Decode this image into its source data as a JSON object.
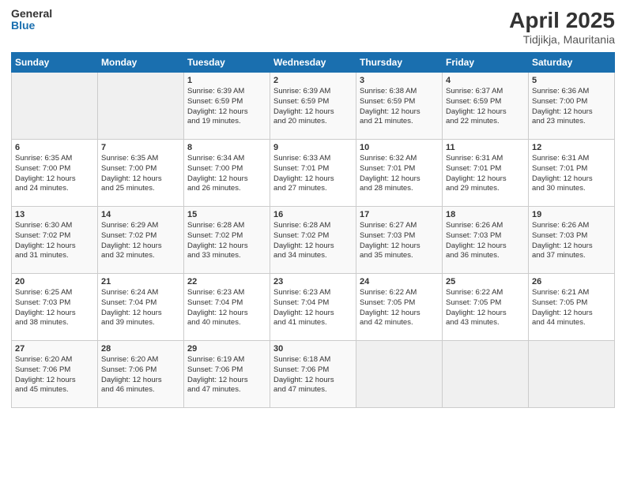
{
  "header": {
    "logo_general": "General",
    "logo_blue": "Blue",
    "title": "April 2025",
    "subtitle": "Tidjikja, Mauritania"
  },
  "calendar": {
    "days_of_week": [
      "Sunday",
      "Monday",
      "Tuesday",
      "Wednesday",
      "Thursday",
      "Friday",
      "Saturday"
    ],
    "weeks": [
      [
        {
          "day": "",
          "info": ""
        },
        {
          "day": "",
          "info": ""
        },
        {
          "day": "1",
          "info": "Sunrise: 6:39 AM\nSunset: 6:59 PM\nDaylight: 12 hours\nand 19 minutes."
        },
        {
          "day": "2",
          "info": "Sunrise: 6:39 AM\nSunset: 6:59 PM\nDaylight: 12 hours\nand 20 minutes."
        },
        {
          "day": "3",
          "info": "Sunrise: 6:38 AM\nSunset: 6:59 PM\nDaylight: 12 hours\nand 21 minutes."
        },
        {
          "day": "4",
          "info": "Sunrise: 6:37 AM\nSunset: 6:59 PM\nDaylight: 12 hours\nand 22 minutes."
        },
        {
          "day": "5",
          "info": "Sunrise: 6:36 AM\nSunset: 7:00 PM\nDaylight: 12 hours\nand 23 minutes."
        }
      ],
      [
        {
          "day": "6",
          "info": "Sunrise: 6:35 AM\nSunset: 7:00 PM\nDaylight: 12 hours\nand 24 minutes."
        },
        {
          "day": "7",
          "info": "Sunrise: 6:35 AM\nSunset: 7:00 PM\nDaylight: 12 hours\nand 25 minutes."
        },
        {
          "day": "8",
          "info": "Sunrise: 6:34 AM\nSunset: 7:00 PM\nDaylight: 12 hours\nand 26 minutes."
        },
        {
          "day": "9",
          "info": "Sunrise: 6:33 AM\nSunset: 7:01 PM\nDaylight: 12 hours\nand 27 minutes."
        },
        {
          "day": "10",
          "info": "Sunrise: 6:32 AM\nSunset: 7:01 PM\nDaylight: 12 hours\nand 28 minutes."
        },
        {
          "day": "11",
          "info": "Sunrise: 6:31 AM\nSunset: 7:01 PM\nDaylight: 12 hours\nand 29 minutes."
        },
        {
          "day": "12",
          "info": "Sunrise: 6:31 AM\nSunset: 7:01 PM\nDaylight: 12 hours\nand 30 minutes."
        }
      ],
      [
        {
          "day": "13",
          "info": "Sunrise: 6:30 AM\nSunset: 7:02 PM\nDaylight: 12 hours\nand 31 minutes."
        },
        {
          "day": "14",
          "info": "Sunrise: 6:29 AM\nSunset: 7:02 PM\nDaylight: 12 hours\nand 32 minutes."
        },
        {
          "day": "15",
          "info": "Sunrise: 6:28 AM\nSunset: 7:02 PM\nDaylight: 12 hours\nand 33 minutes."
        },
        {
          "day": "16",
          "info": "Sunrise: 6:28 AM\nSunset: 7:02 PM\nDaylight: 12 hours\nand 34 minutes."
        },
        {
          "day": "17",
          "info": "Sunrise: 6:27 AM\nSunset: 7:03 PM\nDaylight: 12 hours\nand 35 minutes."
        },
        {
          "day": "18",
          "info": "Sunrise: 6:26 AM\nSunset: 7:03 PM\nDaylight: 12 hours\nand 36 minutes."
        },
        {
          "day": "19",
          "info": "Sunrise: 6:26 AM\nSunset: 7:03 PM\nDaylight: 12 hours\nand 37 minutes."
        }
      ],
      [
        {
          "day": "20",
          "info": "Sunrise: 6:25 AM\nSunset: 7:03 PM\nDaylight: 12 hours\nand 38 minutes."
        },
        {
          "day": "21",
          "info": "Sunrise: 6:24 AM\nSunset: 7:04 PM\nDaylight: 12 hours\nand 39 minutes."
        },
        {
          "day": "22",
          "info": "Sunrise: 6:23 AM\nSunset: 7:04 PM\nDaylight: 12 hours\nand 40 minutes."
        },
        {
          "day": "23",
          "info": "Sunrise: 6:23 AM\nSunset: 7:04 PM\nDaylight: 12 hours\nand 41 minutes."
        },
        {
          "day": "24",
          "info": "Sunrise: 6:22 AM\nSunset: 7:05 PM\nDaylight: 12 hours\nand 42 minutes."
        },
        {
          "day": "25",
          "info": "Sunrise: 6:22 AM\nSunset: 7:05 PM\nDaylight: 12 hours\nand 43 minutes."
        },
        {
          "day": "26",
          "info": "Sunrise: 6:21 AM\nSunset: 7:05 PM\nDaylight: 12 hours\nand 44 minutes."
        }
      ],
      [
        {
          "day": "27",
          "info": "Sunrise: 6:20 AM\nSunset: 7:06 PM\nDaylight: 12 hours\nand 45 minutes."
        },
        {
          "day": "28",
          "info": "Sunrise: 6:20 AM\nSunset: 7:06 PM\nDaylight: 12 hours\nand 46 minutes."
        },
        {
          "day": "29",
          "info": "Sunrise: 6:19 AM\nSunset: 7:06 PM\nDaylight: 12 hours\nand 47 minutes."
        },
        {
          "day": "30",
          "info": "Sunrise: 6:18 AM\nSunset: 7:06 PM\nDaylight: 12 hours\nand 47 minutes."
        },
        {
          "day": "",
          "info": ""
        },
        {
          "day": "",
          "info": ""
        },
        {
          "day": "",
          "info": ""
        }
      ]
    ]
  }
}
